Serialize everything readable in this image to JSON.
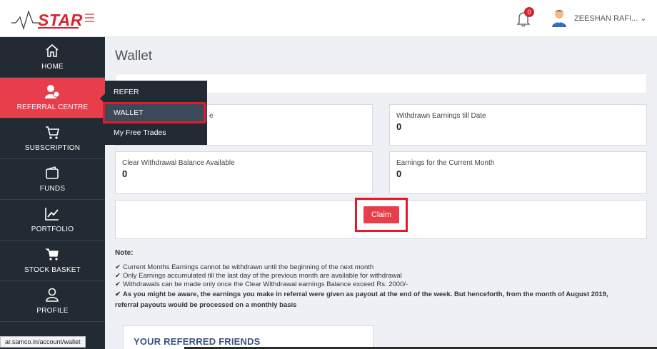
{
  "header": {
    "logo_text": "STAR",
    "notification_count": "0",
    "user_name": "ZEESHAN RAFI... ⌄"
  },
  "sidebar": {
    "items": [
      {
        "label": "HOME",
        "icon": "home-icon"
      },
      {
        "label": "REFERRAL CENTRE",
        "icon": "referral-icon",
        "active": true
      },
      {
        "label": "SUBSCRIPTION",
        "icon": "cart-icon"
      },
      {
        "label": "FUNDS",
        "icon": "wallet-icon"
      },
      {
        "label": "PORTFOLIO",
        "icon": "chart-icon"
      },
      {
        "label": "STOCK BASKET",
        "icon": "basket-icon"
      },
      {
        "label": "PROFILE",
        "icon": "profile-icon"
      }
    ]
  },
  "dropdown": {
    "items": [
      "REFER",
      "WALLET",
      "My Free Trades"
    ],
    "selected": "WALLET"
  },
  "main": {
    "title": "Wallet",
    "cards": [
      {
        "label": "e",
        "value": ""
      },
      {
        "label": "Withdrawn Earnings till Date",
        "value": "0"
      },
      {
        "label": "Clear Withdrawal Balance Available",
        "value": "0"
      },
      {
        "label": "Earnings for the Current Month",
        "value": "0"
      }
    ],
    "claim_label": "Claim",
    "note_title": "Note:",
    "notes": [
      "Current Months Earnings cannot be withdrawn until the beginning of the next month",
      "Only Earnings accumulated till the last day of the previous month are available for withdrawal",
      "Withdrawals can be made only once the Clear Withdrawal earnings Balance exceed Rs. 2000/-",
      "As you might be aware, the earnings you make in referral were given as payout at the end of the week. But henceforth, from the month of August 2019,",
      "referral payouts would be processed on a monthly basis"
    ],
    "friends_title": "YOUR REFERRED FRIENDS"
  },
  "statusbar": {
    "url": "ar.samco.in/account/wallet"
  },
  "colors": {
    "brand_red": "#e83d4b",
    "sidebar_bg": "#222a33",
    "highlight_red": "#e11b2b"
  }
}
